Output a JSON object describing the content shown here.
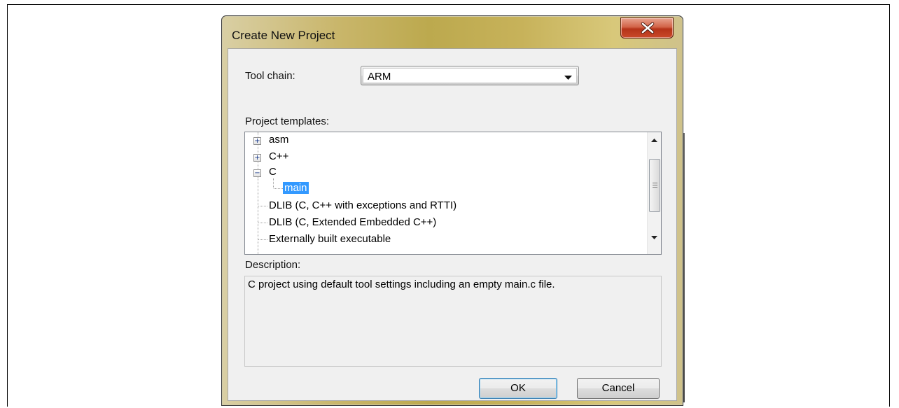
{
  "window": {
    "title": "Create New Project"
  },
  "toolchain": {
    "label": "Tool chain:",
    "value": "ARM"
  },
  "templates": {
    "label": "Project templates:",
    "items": [
      {
        "label": "asm",
        "expander": "+"
      },
      {
        "label": "C++",
        "expander": "+"
      },
      {
        "label": "C",
        "expander": "−"
      },
      {
        "label": "main",
        "selected": true
      },
      {
        "label": "DLIB (C, C++ with exceptions and RTTI)"
      },
      {
        "label": "DLIB (C, Extended Embedded C++)"
      },
      {
        "label": "Externally built executable"
      }
    ]
  },
  "description": {
    "label": "Description:",
    "text": "C project using default tool settings including an empty main.c file."
  },
  "buttons": {
    "ok": "OK",
    "cancel": "Cancel"
  },
  "colors": {
    "selection": "#3399ff",
    "close_button": "#c9492a",
    "title_bar": "#c9b66b"
  }
}
